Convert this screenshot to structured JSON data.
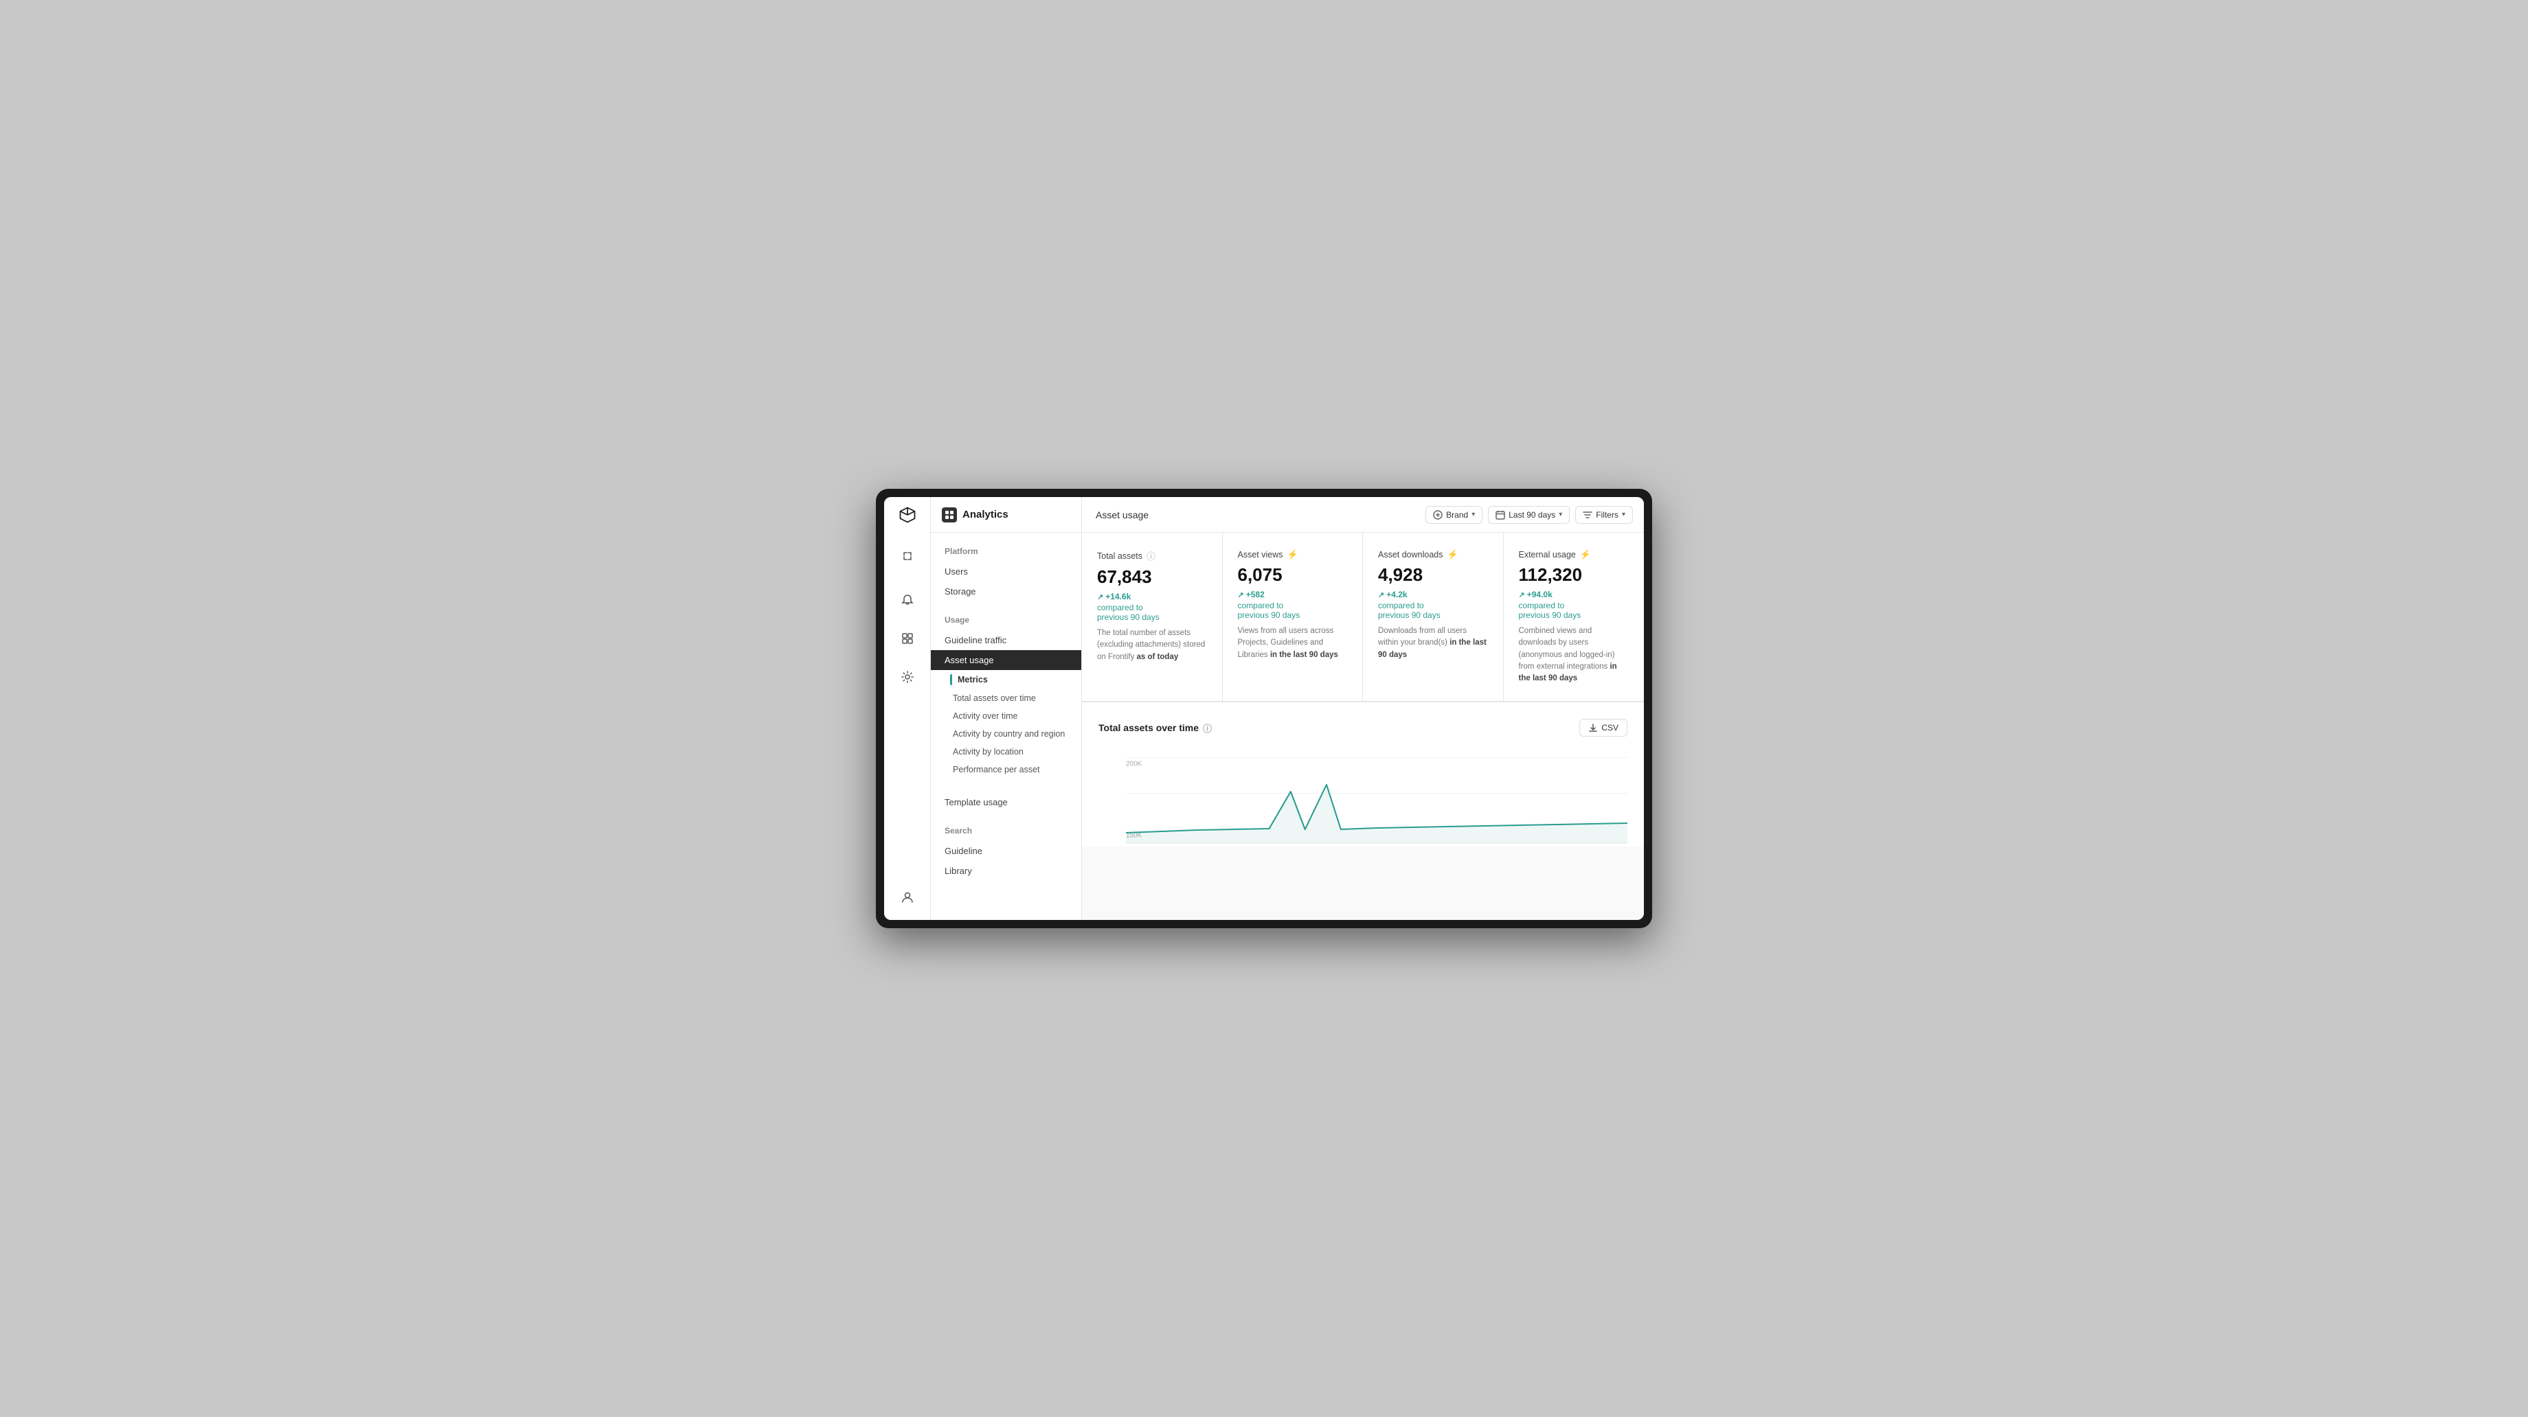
{
  "header": {
    "app_title": "Analytics",
    "page_title": "Asset usage",
    "brand_label": "Brand",
    "date_range_label": "Last 90 days",
    "filters_label": "Filters"
  },
  "sidebar": {
    "platform_section": "Platform",
    "platform_items": [
      {
        "label": "Users",
        "active": false
      },
      {
        "label": "Storage",
        "active": false
      }
    ],
    "usage_section": "Usage",
    "usage_items": [
      {
        "label": "Guideline traffic",
        "active": false
      },
      {
        "label": "Asset usage",
        "active": true
      }
    ],
    "metrics_label": "Metrics",
    "metrics_items": [
      {
        "label": "Total assets over time"
      },
      {
        "label": "Activity over time"
      },
      {
        "label": "Activity by country and region"
      },
      {
        "label": "Activity by location"
      },
      {
        "label": "Performance per asset"
      }
    ],
    "template_usage_label": "Template usage",
    "search_section": "Search",
    "search_items": [
      {
        "label": "Guideline"
      },
      {
        "label": "Library"
      }
    ]
  },
  "stats": [
    {
      "label": "Total assets",
      "value": "67,843",
      "change": "+14.6k",
      "change_text": "compared to",
      "period": "previous 90 days",
      "desc": "The total number of assets (excluding attachments) stored on Frontify",
      "desc_bold": "as of today",
      "has_info_icon": true,
      "has_spark_icon": false
    },
    {
      "label": "Asset views",
      "value": "6,075",
      "change": "+582",
      "change_text": "compared to",
      "period": "previous 90 days",
      "desc": "Views from all users across Projects, Guidelines and Libraries",
      "desc_bold": "in the last 90 days",
      "has_info_icon": false,
      "has_spark_icon": true
    },
    {
      "label": "Asset downloads",
      "value": "4,928",
      "change": "+4.2k",
      "change_text": "compared to",
      "period": "previous 90 days",
      "desc": "Downloads from all users within your brand(s)",
      "desc_bold": "in the last 90 days",
      "has_info_icon": false,
      "has_spark_icon": true
    },
    {
      "label": "External usage",
      "value": "112,320",
      "change": "+94.0k",
      "change_text": "compared to",
      "period": "previous 90 days",
      "desc": "Combined views and downloads by users (anonymous and logged-in) from external integrations",
      "desc_bold": "in the last 90 days",
      "has_info_icon": false,
      "has_spark_icon": true
    }
  ],
  "chart": {
    "title": "Total assets over time",
    "csv_label": "CSV",
    "y_labels": [
      "200K",
      "150K"
    ],
    "y_positions": [
      10,
      45
    ]
  }
}
